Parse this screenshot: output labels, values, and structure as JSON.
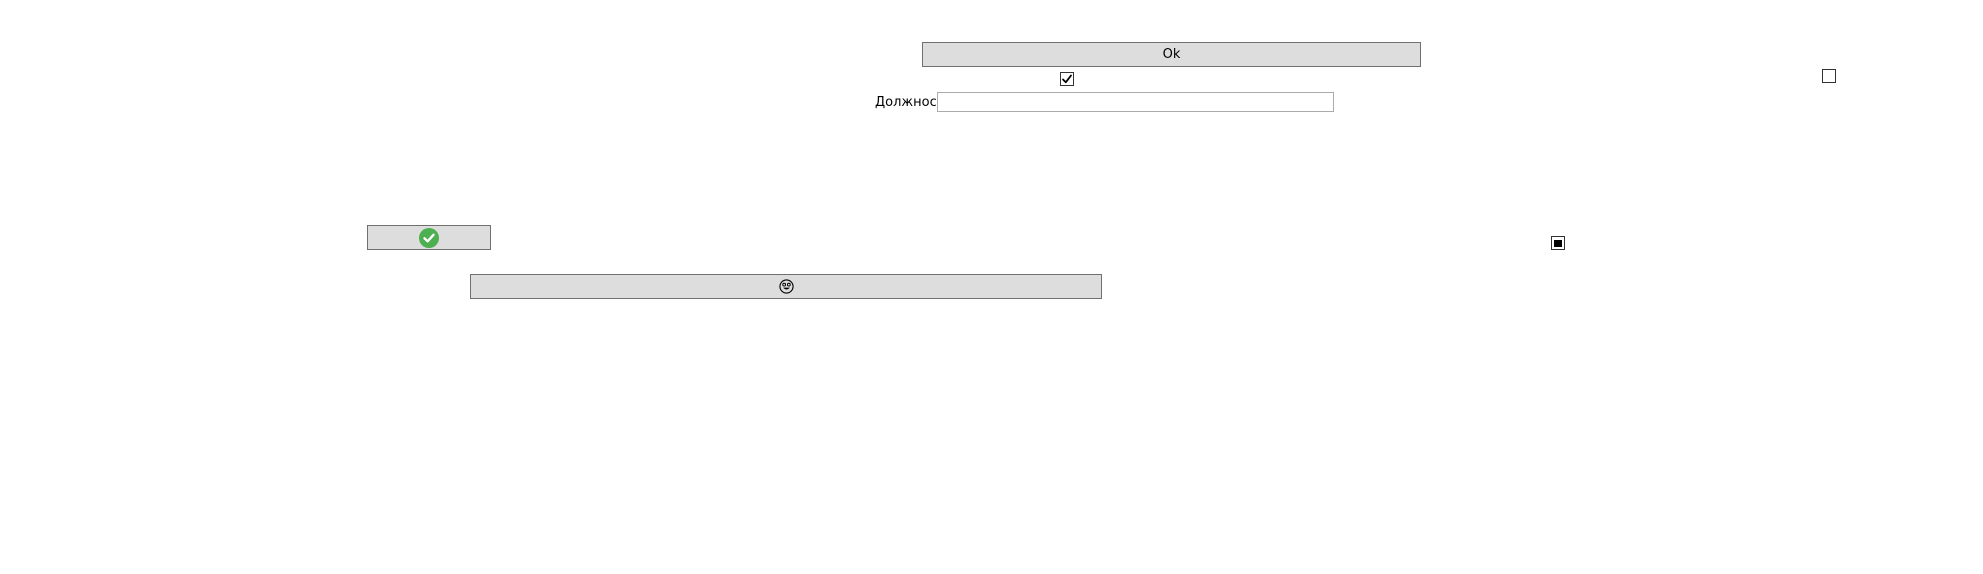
{
  "ok_button": {
    "label": "Ok"
  },
  "checkbox_top_center": {
    "checked": true
  },
  "checkbox_top_right": {
    "checked": false
  },
  "position_field": {
    "label": "Должность",
    "value": "",
    "placeholder": ""
  },
  "confirm_icon_button": {
    "icon": "check-circle-icon",
    "icon_color": "#4caf50"
  },
  "checkbox_middle_right": {
    "state": "indeterminate"
  },
  "smiley_button": {
    "icon": "smiley-face-icon"
  }
}
